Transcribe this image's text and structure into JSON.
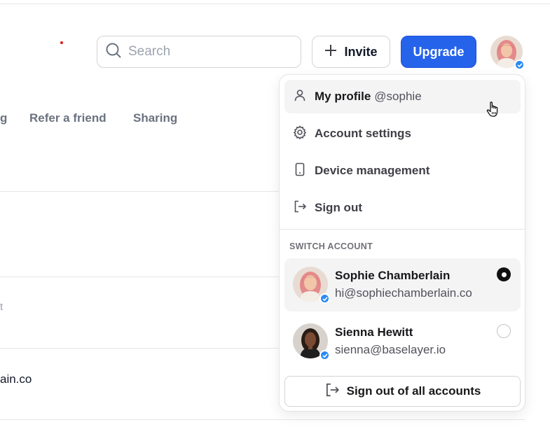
{
  "header": {
    "search": {
      "placeholder": "Search",
      "icon": "search-icon"
    },
    "invite_label": "Invite",
    "upgrade_label": "Upgrade",
    "colors": {
      "upgrade_bg": "#2563eb",
      "verified_badge": "#2b8af5"
    }
  },
  "tabs": [
    {
      "label": "g"
    },
    {
      "label": "Refer a friend"
    },
    {
      "label": "Sharing"
    }
  ],
  "background": {
    "email_fragment": "ain.co",
    "small_fragment": "t"
  },
  "menu": {
    "items": [
      {
        "label": "My profile",
        "handle": "@sophie",
        "icon": "user-icon"
      },
      {
        "label": "Account settings",
        "icon": "gear-icon"
      },
      {
        "label": "Device management",
        "icon": "phone-icon"
      },
      {
        "label": "Sign out",
        "icon": "sign-out-icon"
      }
    ],
    "switch_account_label": "SWITCH ACCOUNT",
    "accounts": [
      {
        "name": "Sophie Chamberlain",
        "email": "hi@sophiechamberlain.co",
        "selected": true
      },
      {
        "name": "Sienna Hewitt",
        "email": "sienna@baselayer.io",
        "selected": false
      }
    ],
    "sign_out_all_label": "Sign out of all accounts"
  }
}
